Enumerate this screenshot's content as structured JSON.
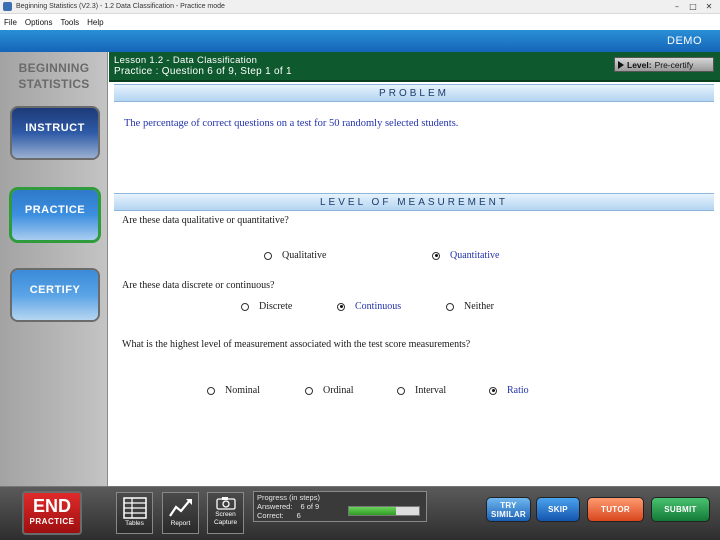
{
  "window": {
    "title": "Beginning Statistics (V2.3) - 1.2  Data Classification  - Practice mode",
    "controls": [
      "–",
      "□",
      "✕"
    ]
  },
  "menu": [
    "File",
    "Options",
    "Tools",
    "Help"
  ],
  "header": {
    "mode_label": "DEMO"
  },
  "sidebar": {
    "brand_line1": "BEGINNING",
    "brand_line2": "STATISTICS",
    "buttons": {
      "instruct": "INSTRUCT",
      "practice": "PRACTICE",
      "certify": "CERTIFY"
    },
    "active": "practice"
  },
  "lesson": {
    "title": "Lesson 1.2 - Data Classification",
    "subtitle": "Practice : Question 6 of 9, Step 1 of 1",
    "level_label": "Level:",
    "level_value": "Pre-certify"
  },
  "problem": {
    "heading": "PROBLEM",
    "text": "The percentage of correct questions on a test for 50 randomly selected students."
  },
  "measurement": {
    "heading": "LEVEL OF MEASUREMENT",
    "questions": [
      {
        "text": "Are these data qualitative or quantitative?",
        "options": [
          "Qualitative",
          "Quantitative"
        ],
        "selected": 1
      },
      {
        "text": "Are these data discrete or continuous?",
        "options": [
          "Discrete",
          "Continuous",
          "Neither"
        ],
        "selected": 1
      },
      {
        "text": "What is the highest level of measurement associated with the test score measurements?",
        "options": [
          "Nominal",
          "Ordinal",
          "Interval",
          "Ratio"
        ],
        "selected": 3
      }
    ]
  },
  "footer": {
    "end": {
      "main": "END",
      "sub": "PRACTICE"
    },
    "tools": {
      "tables": "Tables",
      "report": "Report",
      "capture_line1": "Screen",
      "capture_line2": "Capture"
    },
    "progress": {
      "title": "Progress (in steps)",
      "answered_label": "Answered:",
      "answered_value": "6 of 9",
      "correct_label": "Correct:",
      "correct_value": "6",
      "fraction": 0.6667
    },
    "actions": {
      "try_line1": "TRY",
      "try_line2": "SIMILAR",
      "skip": "SKIP",
      "tutor": "TUTOR",
      "submit": "SUBMIT"
    }
  }
}
